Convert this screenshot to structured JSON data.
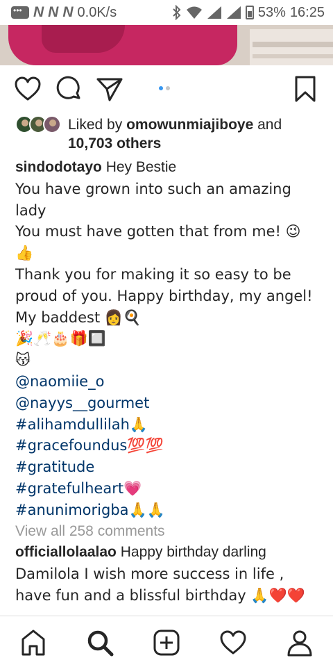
{
  "status_bar": {
    "network_glyphs": [
      "N",
      "N",
      "N"
    ],
    "speed": "0.0K/s",
    "battery": "53%",
    "time": "16:25"
  },
  "post": {
    "carousel_total": 2,
    "carousel_active": 1,
    "likes": {
      "liked_by_prefix": "Liked by",
      "liked_by_user": "omowunmiajiboye",
      "and": "and",
      "others": "10,703 others"
    },
    "caption": {
      "username": "sindodotayo",
      "first_text": "Hey Bestie",
      "lines": [
        "You have grown into such an amazing",
        "lady",
        "You must have gotten that from me! 😉",
        "👍",
        "Thank you for making it so easy to be",
        "proud of you. Happy birthday, my angel!",
        "My baddest 👩🍳",
        "🎉🥂🎂🎁🔲",
        "😽"
      ],
      "tags": [
        "@naomiie_o",
        "@nayys__gourmet",
        "#alihamdullilah🙏",
        "#gracefoundus💯💯",
        "#gratitude",
        "#gratefulheart💗",
        "#anunimorigba🙏🙏"
      ]
    },
    "view_all_comments": "View all 258 comments",
    "comment": {
      "username": "officiallolaalao",
      "text_first": "Happy birthday darling",
      "lines": [
        "Damilola  I wish  more success in life ,",
        "have fun and a blissful birthday 🙏❤️❤️"
      ]
    }
  },
  "icons": {
    "like": "heart-icon",
    "comment": "comment-icon",
    "share": "send-icon",
    "save": "bookmark-icon",
    "home": "home-icon",
    "search": "search-icon",
    "add": "add-post-icon",
    "activity": "heart-icon",
    "profile": "profile-icon"
  },
  "colors": {
    "text": "#262626",
    "link": "#003569",
    "muted": "#999999",
    "accent_dot": "#3897f0"
  }
}
